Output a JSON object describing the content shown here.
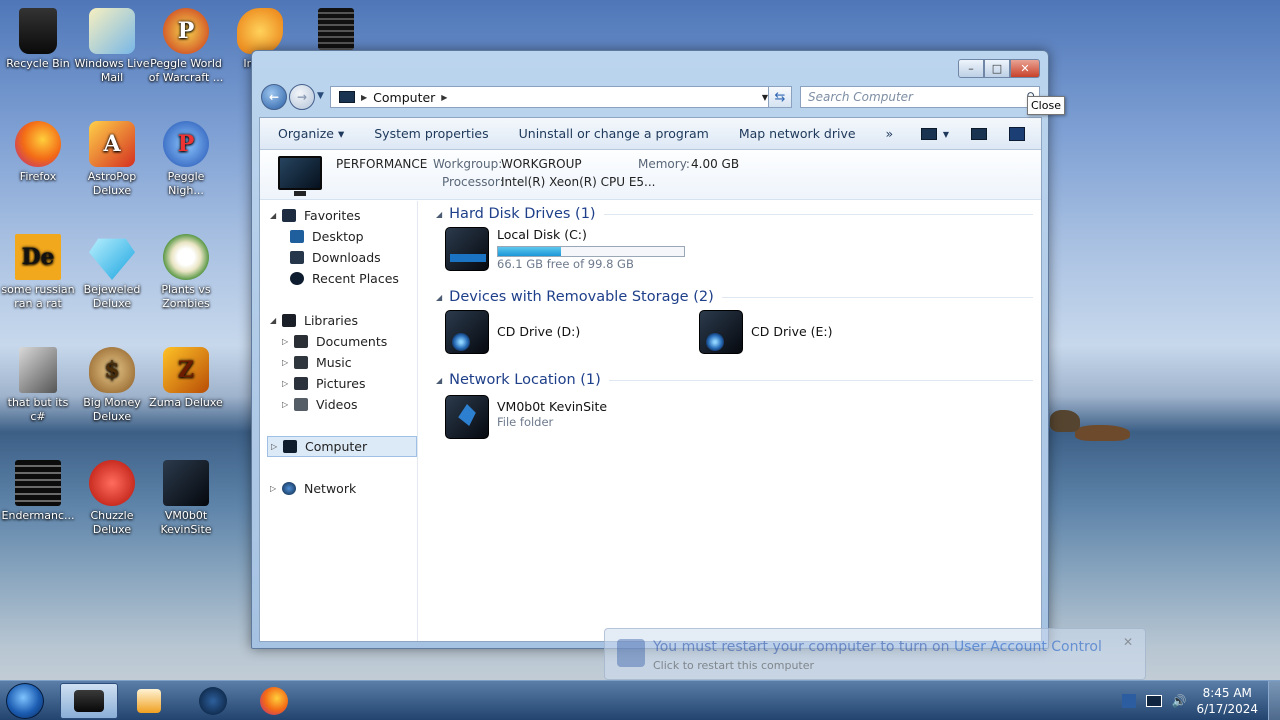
{
  "desktop": {
    "icons": [
      {
        "label": "Recycle Bin"
      },
      {
        "label": "Windows Live Mail"
      },
      {
        "label": "Peggle World of Warcraft ..."
      },
      {
        "label": "Insa..."
      },
      {
        "label": "Firefox"
      },
      {
        "label": "AstroPop Deluxe"
      },
      {
        "label": "Peggle Nigh..."
      },
      {
        "label": "some russian ran a rat"
      },
      {
        "label": "Bejeweled Deluxe"
      },
      {
        "label": "Plants vs Zombies"
      },
      {
        "label": "that but its c#"
      },
      {
        "label": "Big Money Deluxe"
      },
      {
        "label": "Zuma Deluxe"
      },
      {
        "label": "Endermanc..."
      },
      {
        "label": "Chuzzle Deluxe"
      },
      {
        "label": "VM0b0t KevinSite"
      }
    ]
  },
  "window": {
    "address": {
      "path": "Computer"
    },
    "search": {
      "placeholder": "Search Computer"
    },
    "caption": {
      "minimize": "–",
      "maximize": "□",
      "close": "✕"
    },
    "tooltip": "Close",
    "toolbar": {
      "organize": "Organize ▾",
      "system_properties": "System properties",
      "uninstall": "Uninstall or change a program",
      "map_drive": "Map network drive",
      "more": "»"
    },
    "info": {
      "name": "PERFORMANCE",
      "workgroup_label": "Workgroup:",
      "workgroup": "WORKGROUP",
      "memory_label": "Memory:",
      "memory": "4.00 GB",
      "processor_label": "Processor:",
      "processor": "Intel(R) Xeon(R) CPU E5..."
    },
    "nav": {
      "favorites": "Favorites",
      "desktop": "Desktop",
      "downloads": "Downloads",
      "recent": "Recent Places",
      "libraries": "Libraries",
      "documents": "Documents",
      "music": "Music",
      "pictures": "Pictures",
      "videos": "Videos",
      "computer": "Computer",
      "network": "Network"
    },
    "groups": {
      "hdd": "Hard Disk Drives (1)",
      "removable": "Devices with Removable Storage (2)",
      "network": "Network Location (1)"
    },
    "drives": {
      "c": {
        "name": "Local Disk (C:)",
        "free": "66.1 GB free of 99.8 GB",
        "used_fraction": 0.338
      },
      "d": {
        "name": "CD Drive (D:)"
      },
      "e": {
        "name": "CD Drive (E:)"
      },
      "net": {
        "name": "VM0b0t KevinSite",
        "type": "File folder"
      }
    }
  },
  "notification": {
    "title_prefix": "You must restart your computer to turn on ",
    "title_link": "User Account Control",
    "subtitle": "Click to restart this computer"
  },
  "taskbar": {
    "time": "8:45 AM",
    "date": "6/17/2024"
  }
}
